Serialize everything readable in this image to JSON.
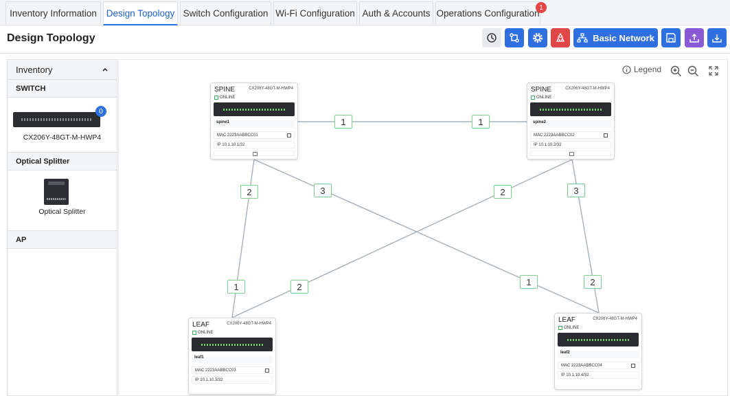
{
  "tabs": [
    {
      "label": "Inventory Information"
    },
    {
      "label": "Design Topology"
    },
    {
      "label": "Switch Configuration"
    },
    {
      "label": "Wi-Fi Configuration"
    },
    {
      "label": "Auth & Accounts"
    },
    {
      "label": "Operations Configuration",
      "badge": "1"
    }
  ],
  "active_tab": "Design Topology",
  "page_title": "Design Topology",
  "toolbar": {
    "basic_network_label": "Basic Network"
  },
  "sidebar": {
    "title": "Inventory",
    "sections": [
      {
        "title": "SWITCH",
        "items": [
          {
            "label": "CX206Y-48GT-M-HWP4",
            "count": "0"
          }
        ]
      },
      {
        "title": "Optical Splitter",
        "items": [
          {
            "label": "Optical Splitter"
          }
        ]
      },
      {
        "title": "AP",
        "items": []
      }
    ]
  },
  "canvas": {
    "legend_label": "Legend",
    "nodes": [
      {
        "role": "SPINE",
        "model": "CX206Y-48GT-M-HWP4",
        "status": "ONLINE",
        "name": "spine1",
        "mac": "MAC 2223AABBCC01",
        "ip": "IP 10.1.10.1/32"
      },
      {
        "role": "SPINE",
        "model": "CX206Y-48GT-M-HWP4",
        "status": "ONLINE",
        "name": "spine2",
        "mac": "MAC 2223AABBCC02",
        "ip": "IP 10.1.10.2/32"
      },
      {
        "role": "LEAF",
        "model": "CX206Y-48GT-M-HWP4",
        "status": "ONLINE",
        "name": "leaf1",
        "mac": "MAC 2223AABBCC03",
        "ip": "IP 10.1.10.3/32"
      },
      {
        "role": "LEAF",
        "model": "CX206Y-48GT-M-HWP4",
        "status": "ONLINE",
        "name": "leaf2",
        "mac": "MAC 2223AABBCC04",
        "ip": "IP 10.1.10.4/32"
      }
    ],
    "link_labels": [
      "1",
      "1",
      "2",
      "3",
      "2",
      "3",
      "1",
      "2",
      "1",
      "2"
    ]
  },
  "colors": {
    "accent": "#2f6fe0",
    "danger": "#e04848",
    "purple": "#8a5ad6",
    "online": "#3cae5a",
    "link": "#a7afb8"
  }
}
